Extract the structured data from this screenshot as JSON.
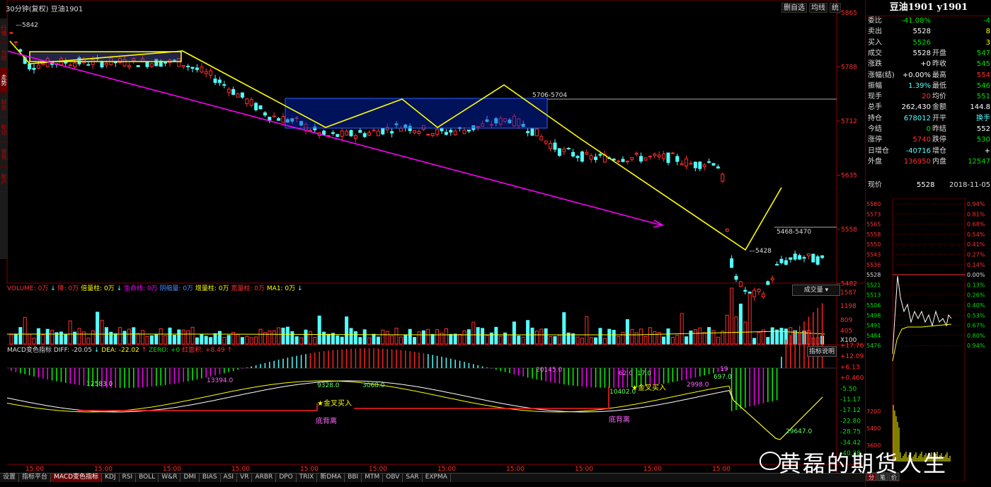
{
  "header": {
    "title": "30分钟(复权)  豆油1901",
    "toolbar": [
      "删自选",
      "均线",
      "统"
    ]
  },
  "sidebar": [
    "行情",
    "分时",
    "走势",
    "财务",
    "标记",
    "资讯",
    "账户"
  ],
  "price_axis": [
    "5865",
    "5788",
    "5712",
    "5635",
    "5558",
    "5482"
  ],
  "annotations": {
    "high_label": "5842",
    "range_label_1": "5706-5704",
    "range_label_2": "5468-5470",
    "low_label": "5428",
    "golden_cross_1": "★金叉买入",
    "golden_cross_2": "★金叉买入",
    "divergence_1": "底背离",
    "divergence_2": "底背离"
  },
  "volume_panel": {
    "legend": [
      {
        "text": "VOLUME: 0万",
        "color": "#ff3030"
      },
      {
        "text": "↓",
        "color": "#54ffff"
      },
      {
        "text": "降: 0万",
        "color": "#ff3030"
      },
      {
        "text": "倍量柱: 0万",
        "color": "#ffff00"
      },
      {
        "text": "↓",
        "color": "#54ffff"
      },
      {
        "text": "生命线: 0万",
        "color": "#ff00ff"
      },
      {
        "text": "阴缩量: 0万",
        "color": "#4a8cff"
      },
      {
        "text": "增量柱: 0万",
        "color": "#ffff00"
      },
      {
        "text": "宽量柱: 0万",
        "color": "#ff3030"
      },
      {
        "text": "MA1: 0万",
        "color": "#ffff00"
      },
      {
        "text": "↓",
        "color": "#54ffff"
      }
    ],
    "button": "成交量",
    "axis": [
      "1587",
      "1198",
      "809",
      "405",
      "X100"
    ]
  },
  "macd_panel": {
    "legend": [
      {
        "text": "MACD变色指标",
        "color": "#ddd"
      },
      {
        "text": "DIFF: -20.05",
        "color": "#ddd"
      },
      {
        "text": "↓",
        "color": "#54ffff"
      },
      {
        "text": "DEA: -22.02",
        "color": "#ffff00"
      },
      {
        "text": "↑",
        "color": "#ff3030"
      },
      {
        "text": "ZERO: +0",
        "color": "#00e000"
      },
      {
        "text": "红面积: +8.49",
        "color": "#ff3030"
      },
      {
        "text": "↑",
        "color": "#ff3030"
      }
    ],
    "button": "指标说明",
    "axis": [
      "+17.76",
      "+12.09",
      "+6.13",
      "+0.460",
      "-5.50",
      "-11.17",
      "-17.12",
      "-22.80",
      "-28.75",
      "-34.42",
      "-40.38"
    ],
    "values": [
      "12583.0",
      "13394.0",
      "9328.0",
      "3068.0",
      "20145.0",
      "62.0",
      "17.0",
      "10402.0",
      "2998.0",
      "19",
      "697.0",
      "29647.0"
    ]
  },
  "time_labels": [
    "15:00",
    "15:00",
    "15:00",
    "15:00",
    "15:00",
    "15:00",
    "15:00",
    "15:00",
    "15:00",
    "15:00",
    "15:00"
  ],
  "bottom_tabs": [
    "设置",
    "指标平台",
    "MACD变色指标",
    "KDJ",
    "RSI",
    "BOLL",
    "W&R",
    "DMI",
    "BIAS",
    "ASI",
    "VR",
    "ARBR",
    "DPO",
    "TRIX",
    "新DMA",
    "BBI",
    "MTM",
    "OBV",
    "SAR",
    "EXPMA"
  ],
  "quote": {
    "title": "豆油1901 y1901",
    "rows": [
      {
        "l": "委比",
        "v": "-41.08%",
        "vc": "green",
        "l2": "",
        "v2": "-4",
        "v2c": "green"
      },
      {
        "l": "卖出",
        "v": "5528",
        "vc": "white",
        "l2": "",
        "v2": "8",
        "v2c": "yellow"
      },
      {
        "l": "买入",
        "v": "5526",
        "vc": "green",
        "l2": "",
        "v2": "3",
        "v2c": "yellow"
      },
      {
        "l": "成交",
        "v": "5528",
        "vc": "white",
        "l2": "开盘",
        "v2": "547",
        "v2c": "green"
      },
      {
        "l": "涨跌",
        "v": "+0",
        "vc": "white",
        "l2": "昨收",
        "v2": "545",
        "v2c": "green"
      },
      {
        "l": "涨幅(结)",
        "v": "+0.00%",
        "vc": "white",
        "l2": "最高",
        "v2": "554",
        "v2c": "red"
      },
      {
        "l": "振幅",
        "v": "1.39%",
        "vc": "cyan",
        "l2": "最低",
        "v2": "546",
        "v2c": "green"
      },
      {
        "l": "现手",
        "v": "20",
        "vc": "red",
        "l2": "均价",
        "v2": "551",
        "v2c": "green"
      },
      {
        "l": "总手",
        "v": "262,430",
        "vc": "white",
        "l2": "金额",
        "v2": "144.8",
        "v2c": "white"
      },
      {
        "l": "持仓",
        "v": "678012",
        "vc": "cyan",
        "l2": "开平",
        "v2": "换手",
        "v2c": "cyan"
      },
      {
        "l": "今结",
        "v": "0",
        "vc": "green",
        "l2": "昨结",
        "v2": "552",
        "v2c": "white"
      },
      {
        "l": "涨停",
        "v": "5740",
        "vc": "red",
        "l2": "跌停",
        "v2": "530",
        "v2c": "green"
      },
      {
        "l": "日增仓",
        "v": "-40716",
        "vc": "cyan",
        "l2": "增仓",
        "v2": "+",
        "v2c": "white"
      },
      {
        "l": "外盘",
        "v": "136950",
        "vc": "red",
        "l2": "内盘",
        "v2": "12547",
        "v2c": "green"
      }
    ],
    "last_row": {
      "l": "现价",
      "price": "5528",
      "time": "2018-11-05,"
    },
    "mini_axis_left": [
      "5580",
      "5573",
      "5565",
      "5558",
      "5550",
      "5543",
      "5536",
      "5528",
      "5521",
      "5513",
      "5506",
      "5498",
      "5491",
      "5484",
      "5476"
    ],
    "mini_axis_right": [
      "0.94%",
      "0.81%",
      "0.68%",
      "0.54%",
      "0.41%",
      "0.27%",
      "0.14%",
      "0.00%",
      "0.13%",
      "0.26%",
      "0.40%",
      "0.53%",
      "0.67%",
      "0.80%",
      "0.94%"
    ],
    "vol_axis": [
      "7200",
      "5400",
      "3600"
    ],
    "bottom_tabs": [
      "分",
      "笔",
      "价"
    ]
  },
  "watermark": "黄磊的期货人生"
}
